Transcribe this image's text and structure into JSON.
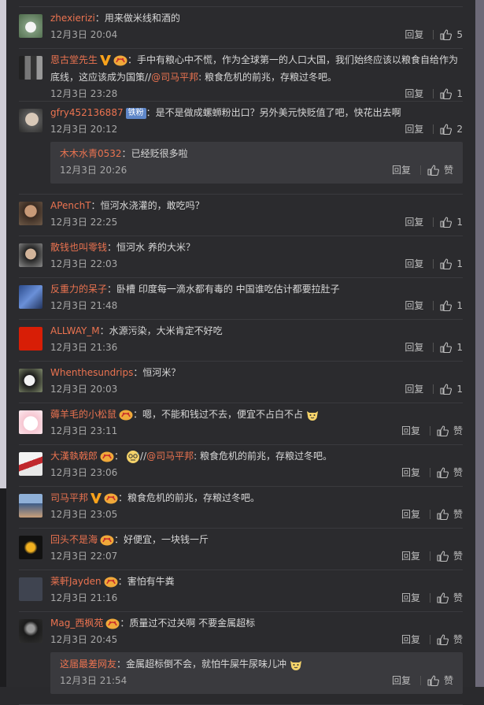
{
  "comments": [
    {
      "avatar": "lotus-avatar",
      "name": "zhexierizi",
      "text": "用来做米线和酒的",
      "time": "12月3日 20:04",
      "reply": "回复",
      "likes": "5"
    },
    {
      "avatar": "bw-photo-avatar",
      "name": "恩古堂先生",
      "verified": true,
      "vip": true,
      "text_a": "手中有粮心中不慌，作为全球第一的人口大国，我们始终应该以粮食自给作为底线，这应该成为国策//",
      "mention": "@司马平邦",
      "text_b": ": 粮食危机的前兆，存粮过冬吧。",
      "time": "12月3日 23:28",
      "reply": "回复",
      "likes": "1"
    },
    {
      "avatar": "face-avatar",
      "name": "gfry452136887",
      "tag": "铁粉",
      "text": "是不是做成螺蛳粉出口？另外美元快贬值了吧，快花出去啊",
      "time": "12月3日 20:12",
      "reply": "回复",
      "likes": "2",
      "sub": {
        "name": "木木水青0532",
        "text": "已经贬很多啦",
        "time": "12月3日 20:26",
        "reply": "回复",
        "likes": "赞"
      }
    },
    {
      "avatar": "man-avatar",
      "name": "APenchT",
      "text": "恒河水浇灌的，敢吃吗？",
      "time": "12月3日 22:25",
      "reply": "回复",
      "likes": "1"
    },
    {
      "avatar": "guy-avatar",
      "name": "散钱也叫零钱",
      "text": "恒河水 养的大米？",
      "time": "12月3日 22:03",
      "reply": "回复",
      "likes": "1"
    },
    {
      "avatar": "blue-avatar",
      "name": "反重力的呆子",
      "text": "卧槽 印度每一滴水都有毒的 中国谁吃估计都要拉肚子",
      "time": "12月3日 21:48",
      "reply": "回复",
      "likes": "1"
    },
    {
      "avatar": "flag-avatar",
      "name": "ALLWAY_M",
      "text": "水源污染，大米肯定不好吃",
      "time": "12月3日 21:36",
      "reply": "回复",
      "likes": "1"
    },
    {
      "avatar": "panda-avatar",
      "name": "Whenthesundrips",
      "text": "恒河米？",
      "time": "12月3日 20:03",
      "reply": "回复",
      "likes": "1"
    },
    {
      "avatar": "cartoon-avatar",
      "name": "薅羊毛的小松鼠",
      "vip": true,
      "text": "嗯，不能和钱过不去，便宜不占白不占",
      "emoji": "cat",
      "time": "12月3日 23:11",
      "reply": "回复",
      "likes": "赞"
    },
    {
      "avatar": "red-avatar",
      "name": "大漢執戟郎",
      "vip": true,
      "pre": "：",
      "emoji_pre": "sweat",
      "text_a": "//",
      "mention": "@司马平邦",
      "text_b": ": 粮食危机的前兆，存粮过冬吧。",
      "time": "12月3日 23:06",
      "reply": "回复",
      "likes": "赞"
    },
    {
      "avatar": "people-avatar",
      "name": "司马平邦",
      "verified": true,
      "vip": true,
      "text": "粮食危机的前兆，存粮过冬吧。",
      "time": "12月3日 23:05",
      "reply": "回复",
      "likes": "赞"
    },
    {
      "avatar": "wings-avatar",
      "name": "回头不是海",
      "vip": true,
      "text": "好便宜，一块钱一斤",
      "time": "12月3日 22:07",
      "reply": "回复",
      "likes": "赞"
    },
    {
      "avatar": "text-avatar",
      "name": "莱軒Jayden",
      "vip": true,
      "text": "害怕有牛粪",
      "time": "12月3日 21:16",
      "reply": "回复",
      "likes": "赞"
    },
    {
      "avatar": "dark-avatar",
      "name": "Mag_西枫苑",
      "vip": true,
      "text": "质量过不过关啊 不要金属超标",
      "time": "12月3日 20:45",
      "reply": "回复",
      "likes": "赞",
      "sub": {
        "name": "这届最差网友",
        "text": "金属超标倒不会，就怕牛屎牛尿味儿冲",
        "emoji": "cat",
        "time": "12月3日 21:54",
        "reply": "回复",
        "likes": "赞"
      }
    }
  ]
}
